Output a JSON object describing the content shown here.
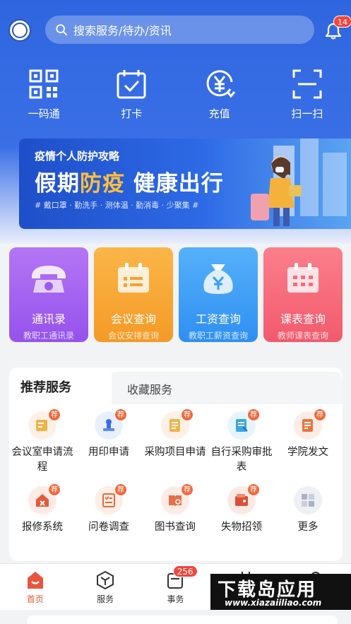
{
  "search": {
    "placeholder": "搜索服务/待办/资讯"
  },
  "notifications": {
    "count": "14"
  },
  "quick_actions": [
    {
      "label": "一码通",
      "icon": "qrcode-icon"
    },
    {
      "label": "打卡",
      "icon": "checkin-icon"
    },
    {
      "label": "充值",
      "icon": "recharge-icon"
    },
    {
      "label": "扫一扫",
      "icon": "scan-icon"
    }
  ],
  "banner": {
    "subtitle": "疫情个人防护攻略",
    "title_part1": "假期",
    "title_highlight": "防疫",
    "title_part2": "健康出行",
    "tags": "# 戴口罩 · 勤洗手 · 测体温 · 勤消毒 · 少聚集 #"
  },
  "feature_cards": [
    {
      "title": "通讯录",
      "subtitle": "教职工通讯录",
      "icon": "phone-icon",
      "color": "#a15cf0"
    },
    {
      "title": "会议查询",
      "subtitle": "会议安排查询",
      "icon": "meeting-icon",
      "color": "#f7a432"
    },
    {
      "title": "工资查询",
      "subtitle": "教职工薪资查询",
      "icon": "money-bag-icon",
      "color": "#3b9cf5"
    },
    {
      "title": "课表查询",
      "subtitle": "教师课表查询",
      "icon": "calendar-icon",
      "color": "#f56b7a"
    }
  ],
  "services": {
    "tabs": [
      "推荐服务",
      "收藏服务"
    ],
    "recommend_badge": "荐",
    "items": [
      {
        "label": "会议室申请流程",
        "icon": "meeting-room-icon"
      },
      {
        "label": "用印申请",
        "icon": "seal-icon"
      },
      {
        "label": "采购项目申请",
        "icon": "purchase-icon"
      },
      {
        "label": "自行采购审批表",
        "icon": "approval-icon"
      },
      {
        "label": "学院发文",
        "icon": "document-icon"
      },
      {
        "label": "报修系统",
        "icon": "repair-icon"
      },
      {
        "label": "问卷调查",
        "icon": "survey-icon"
      },
      {
        "label": "图书查询",
        "icon": "book-icon"
      },
      {
        "label": "失物招领",
        "icon": "wallet-icon"
      },
      {
        "label": "更多",
        "icon": "more-icon"
      }
    ]
  },
  "nav": [
    {
      "label": "首页",
      "icon": "home-icon",
      "active": true
    },
    {
      "label": "服务",
      "icon": "service-icon"
    },
    {
      "label": "事务",
      "icon": "affairs-icon",
      "badge": "256"
    },
    {
      "label": "",
      "icon": "calendar-icon"
    },
    {
      "label": "",
      "icon": "profile-icon"
    }
  ],
  "watermark": {
    "text": "下载岛应用",
    "url": "www.xiazaiiliao.com"
  },
  "colors": {
    "primary": "#2f66df",
    "accent": "#e9553c",
    "highlight": "#ffbf3d"
  }
}
